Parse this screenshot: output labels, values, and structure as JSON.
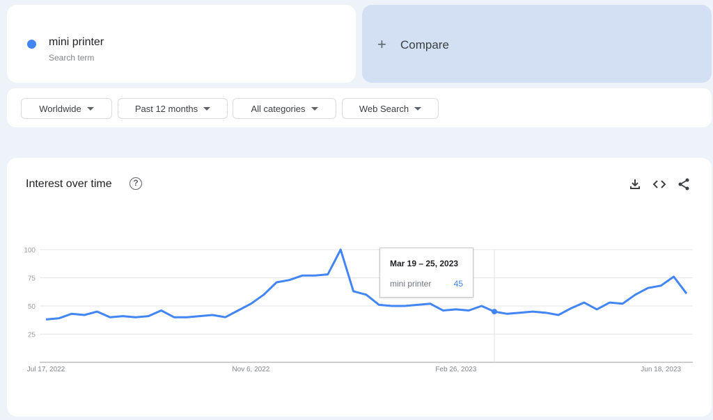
{
  "search_term": {
    "name": "mini printer",
    "subtitle": "Search term",
    "color": "#4285f4"
  },
  "compare": {
    "icon": "plus-icon",
    "label": "Compare"
  },
  "filters": [
    {
      "label": "Worldwide"
    },
    {
      "label": "Past 12 months"
    },
    {
      "label": "All categories"
    },
    {
      "label": "Web Search"
    }
  ],
  "panel": {
    "title": "Interest over time",
    "help_icon": "?",
    "actions": [
      "download-icon",
      "embed-code-icon",
      "share-icon"
    ]
  },
  "tooltip": {
    "date": "Mar 19 – 25, 2023",
    "series": "mini printer",
    "value": "45",
    "index": 35
  },
  "chart_data": {
    "type": "line",
    "title": "Interest over time",
    "xlabel": "",
    "ylabel": "",
    "ylim": [
      0,
      100
    ],
    "yticks": [
      25,
      50,
      75,
      100
    ],
    "grid": true,
    "x_tick_labels": [
      {
        "index": 0,
        "label": "Jul 17, 2022"
      },
      {
        "index": 16,
        "label": "Nov 6, 2022"
      },
      {
        "index": 32,
        "label": "Feb 26, 2023"
      },
      {
        "index": 48,
        "label": "Jun 18, 2023"
      }
    ],
    "series": [
      {
        "name": "mini printer",
        "color": "#4285f4",
        "values": [
          38,
          39,
          43,
          42,
          45,
          40,
          41,
          40,
          41,
          46,
          40,
          40,
          41,
          42,
          40,
          46,
          52,
          60,
          71,
          73,
          77,
          77,
          78,
          100,
          63,
          60,
          51,
          50,
          50,
          51,
          52,
          46,
          47,
          46,
          50,
          45,
          43,
          44,
          45,
          44,
          42,
          48,
          53,
          47,
          53,
          52,
          60,
          66,
          68,
          76,
          61
        ]
      }
    ]
  }
}
